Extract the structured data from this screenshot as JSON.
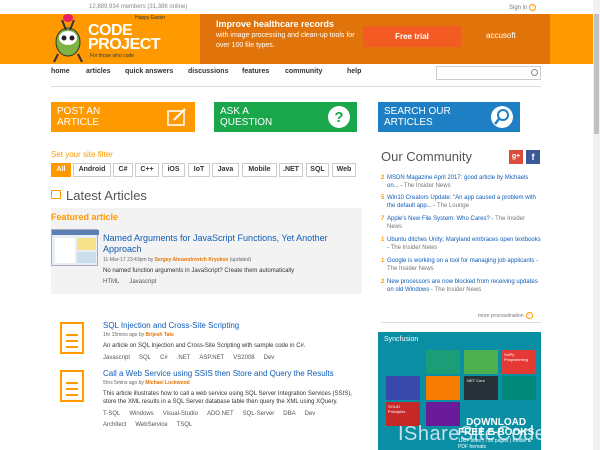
{
  "top": {
    "members": "12,889,934 members (31,386 online)",
    "signin": "Sign in"
  },
  "logo": {
    "easter": "Happy Easter",
    "code": "CODE",
    "project": "PROJECT",
    "tagline": "For those who code"
  },
  "ad": {
    "title": "Improve healthcare records",
    "desc": "with image processing and clean-up tools for over 100 file types.",
    "button": "Free trial",
    "brand": "accusoft"
  },
  "nav": {
    "items": [
      "home",
      "articles",
      "quick answers",
      "discussions",
      "features",
      "community",
      "help"
    ]
  },
  "tiles": [
    {
      "label1": "POST AN",
      "label2": "ARTICLE",
      "color": "#f90",
      "icon": "edit-icon"
    },
    {
      "label1": "ASK A",
      "label2": "QUESTION",
      "color": "#1aa64a",
      "icon": "question-icon"
    },
    {
      "label1": "SEARCH OUR",
      "label2": "ARTICLES",
      "color": "#1e7fc4",
      "icon": "search-icon"
    }
  ],
  "filter": {
    "label": "Set your site filter",
    "tags": [
      "All",
      "Android",
      "C#",
      "C++",
      "iOS",
      "IoT",
      "Java",
      "Mobile",
      ".NET",
      "SQL",
      "Web"
    ]
  },
  "latest": {
    "title": "Latest Articles"
  },
  "featured": {
    "label": "Featured article",
    "title": "Named Arguments for JavaScript Functions, Yet Another Approach",
    "date": "11-Mar-17 23:43pm",
    "by": "by",
    "author": "Sergey Alexandrovich Kryukov",
    "updated": "(updated)",
    "desc": "No named function arguments in JavaScript? Create them automatically",
    "tags": [
      "HTML",
      "Javascript"
    ]
  },
  "articles": [
    {
      "title": "SQL Injection and Cross-Site Scripting",
      "meta": "1hr 15mins ago",
      "by": "by",
      "author": "Brijesh Tate",
      "desc": "An article on SQL Injection and Cross-Site Scripting with sample code in C#.",
      "tags": [
        "Javascript",
        "SQL",
        "C#",
        ".NET",
        "ASP.NET",
        "VS2008",
        "Dev"
      ]
    },
    {
      "title": "Call a Web Service using SSIS then Store and Query the Results",
      "meta": "5hrs 5mins ago",
      "by": "by",
      "author": "Michael Lockwood",
      "desc": "This article illustrates how to call a web service using SQL Server Integration Services (SSIS), store the XML results in a SQL Server database table then query the XML using XQuery.",
      "tags": [
        "T-SQL",
        "Windows",
        "Visual-Studio",
        "ADO.NET",
        "SQL-Server",
        "DBA",
        "Dev",
        "Architect",
        "WebService",
        "TSQL"
      ]
    }
  ],
  "community": {
    "title": "Our Community",
    "social": [
      "g+",
      "f"
    ],
    "news": [
      {
        "n": "2",
        "text": "MSDN Magazine April 2017: good article by Michaels on...",
        "src": "The Insider News"
      },
      {
        "n": "5",
        "text": "Win10 Creators Update: \"An app caused a problem with the default app...",
        "src": "The Lounge"
      },
      {
        "n": "7",
        "text": "Apple's New File System: Who Cares?",
        "src": "The Insider News"
      },
      {
        "n": "1",
        "text": "Ubuntu ditches Unity; Maryland embraces open textbooks",
        "src": "The Insider News"
      },
      {
        "n": "1",
        "text": "Google is working on a tool for managing job applicants",
        "src": "The Insider News"
      },
      {
        "n": "2",
        "text": "New processors are now blocked from receiving updates on old Windows",
        "src": "The Insider News"
      }
    ],
    "more": "more procrastination"
  },
  "sfad": {
    "brand": "Syncfusion",
    "books": [
      "SciPy Programming",
      ".NET Core",
      "SOLID Principles"
    ],
    "download": "DOWNLOAD",
    "free": "FREE E-BOOKS",
    "sub": "100+ titles | 700 pages | Kindle & PDF formats"
  },
  "watermark": "IShareSiteCode.com"
}
